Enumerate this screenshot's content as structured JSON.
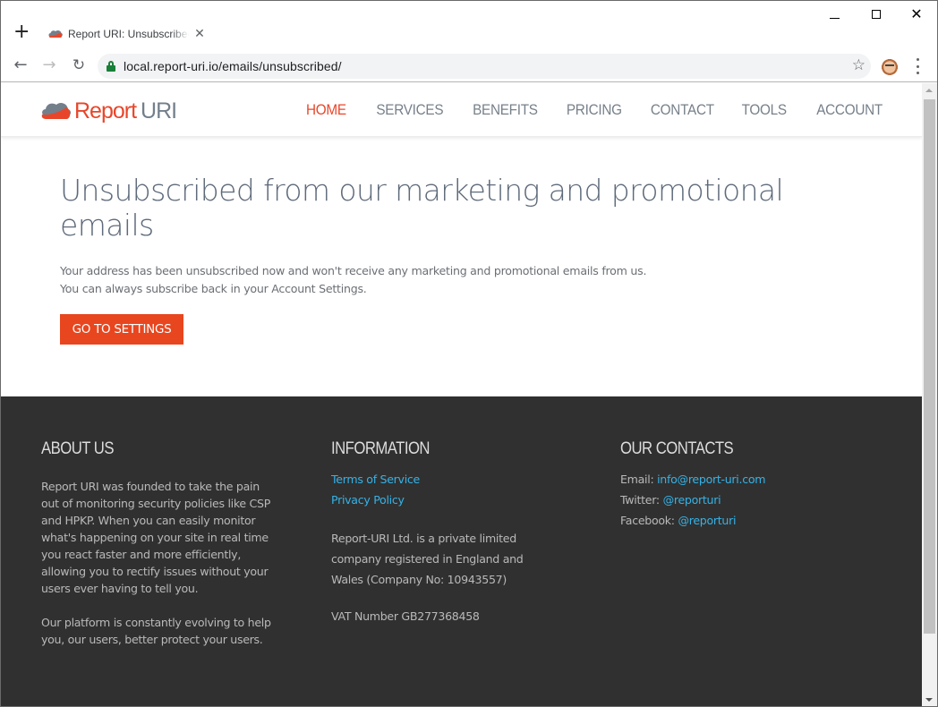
{
  "browser": {
    "tab": {
      "title": "Report URI: Unsubscribed",
      "favicon": "report-uri-cloud-icon",
      "close_icon": "close-icon"
    },
    "new_tab_icon": "plus-icon",
    "window_controls": {
      "minimize": "minimize-icon",
      "maximize": "maximize-icon",
      "close": "close-icon"
    },
    "nav": {
      "back": "arrow-left-icon",
      "forward": "arrow-right-icon",
      "reload": "reload-icon"
    },
    "address_bar": {
      "secure_icon": "lock-icon",
      "url": "local.report-uri.io/emails/unsubscribed/",
      "bookmark_icon": "star-icon"
    },
    "profile_icon": "avatar",
    "menu_icon": "more-vertical-icon"
  },
  "glyphs": {
    "plus": "+",
    "close": "✕",
    "back": "←",
    "forward": "→",
    "reload": "↻",
    "star": "☆"
  },
  "site": {
    "logo": {
      "part1": "Report",
      "part2": "URI"
    },
    "nav": [
      {
        "label": "HOME",
        "active": true
      },
      {
        "label": "SERVICES",
        "active": false
      },
      {
        "label": "BENEFITS",
        "active": false
      },
      {
        "label": "PRICING",
        "active": false
      },
      {
        "label": "CONTACT",
        "active": false
      },
      {
        "label": "TOOLS",
        "active": false
      },
      {
        "label": "ACCOUNT",
        "active": false
      }
    ],
    "colors": {
      "brand": "#e8462a",
      "nav_text": "#77808a",
      "footer_bg": "#303030",
      "link": "#36b2e6"
    }
  },
  "main": {
    "title": "Unsubscribed from our marketing and promotional emails",
    "lines": [
      "Your address has been unsubscribed now and won't receive any marketing and promotional emails from us.",
      "You can always subscribe back in your Account Settings."
    ],
    "cta_label": "GO TO SETTINGS"
  },
  "footer": {
    "about": {
      "heading": "ABOUT US",
      "p1": "Report URI was founded to take the pain out of monitoring security policies like CSP and HPKP. When you can easily monitor what's happening on your site in real time you react faster and more efficiently, allowing you to rectify issues without your users ever having to tell you.",
      "p2": "Our platform is constantly evolving to help you, our users, better protect your users."
    },
    "information": {
      "heading": "INFORMATION",
      "links": [
        "Terms of Service",
        "Privacy Policy"
      ],
      "company": "Report-URI Ltd. is a private limited company registered in England and Wales (Company No: 10943557)",
      "vat": "VAT Number GB277368458"
    },
    "contacts": {
      "heading": "OUR CONTACTS",
      "items": [
        {
          "label": "Email:",
          "value": "info@report-uri.com"
        },
        {
          "label": "Twitter:",
          "value": "@reporturi"
        },
        {
          "label": "Facebook:",
          "value": "@reporturi"
        }
      ]
    }
  }
}
